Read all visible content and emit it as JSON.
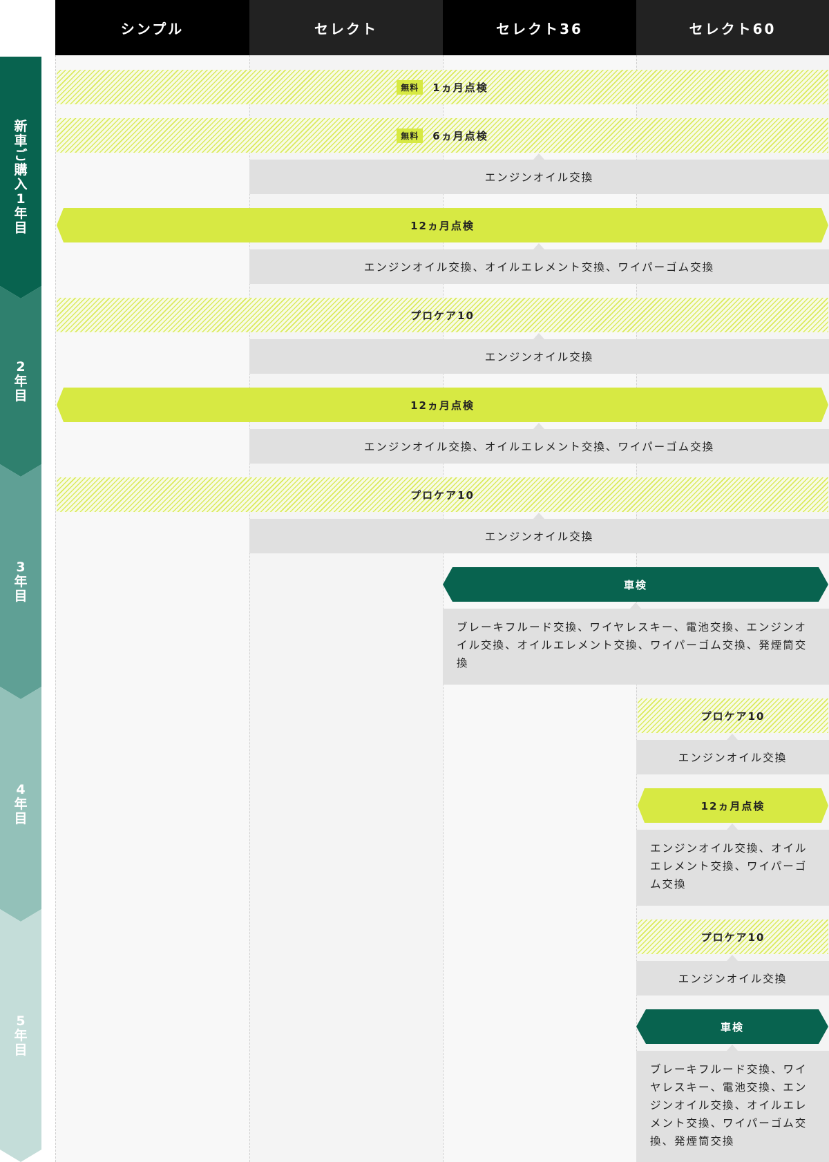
{
  "columns": [
    "シンプル",
    "セレクト",
    "セレクト36",
    "セレクト60"
  ],
  "years": [
    "新車ご購入1年目",
    "2年目",
    "3年目",
    "4年目",
    "5年目"
  ],
  "colors": {
    "header_dark": "#000000",
    "header_alt": "#222222",
    "lime": "#d7e943",
    "green": "#08634f",
    "gray_box": "#e0e0e0",
    "year_band": [
      "#08634f",
      "#2f806e",
      "#5fa095",
      "#93c1b9",
      "#c4ddd9"
    ]
  },
  "items": {
    "inspect_1m": {
      "badge": "無料",
      "label": "1ヵ月点検"
    },
    "inspect_6m": {
      "badge": "無料",
      "label": "6ヵ月点検"
    },
    "oil_1": "エンジンオイル交換",
    "inspect_12m_1": "12ヵ月点検",
    "work_12m_1": "エンジンオイル交換、オイルエレメント交換、ワイパーゴム交換",
    "procare_1": "プロケア10",
    "oil_2": "エンジンオイル交換",
    "inspect_12m_2": "12ヵ月点検",
    "work_12m_2": "エンジンオイル交換、オイルエレメント交換、ワイパーゴム交換",
    "procare_2": "プロケア10",
    "oil_3": "エンジンオイル交換",
    "shaken_1": "車検",
    "shaken_work_1": "ブレーキフルード交換、ワイヤレスキー、電池交換、エンジンオイル交換、オイルエレメント交換、ワイパーゴム交換、発煙筒交換",
    "procare_3": "プロケア10",
    "oil_4": "エンジンオイル交換",
    "inspect_12m_3": "12ヵ月点検",
    "work_12m_3": "エンジンオイル交換、オイルエレメント交換、ワイパーゴム交換",
    "procare_4": "プロケア10",
    "oil_5": "エンジンオイル交換",
    "shaken_2": "車検",
    "shaken_work_2": "ブレーキフルード交換、ワイヤレスキー、電池交換、エンジンオイル交換、オイルエレメント交換、ワイパーゴム交換、発煙筒交換"
  }
}
